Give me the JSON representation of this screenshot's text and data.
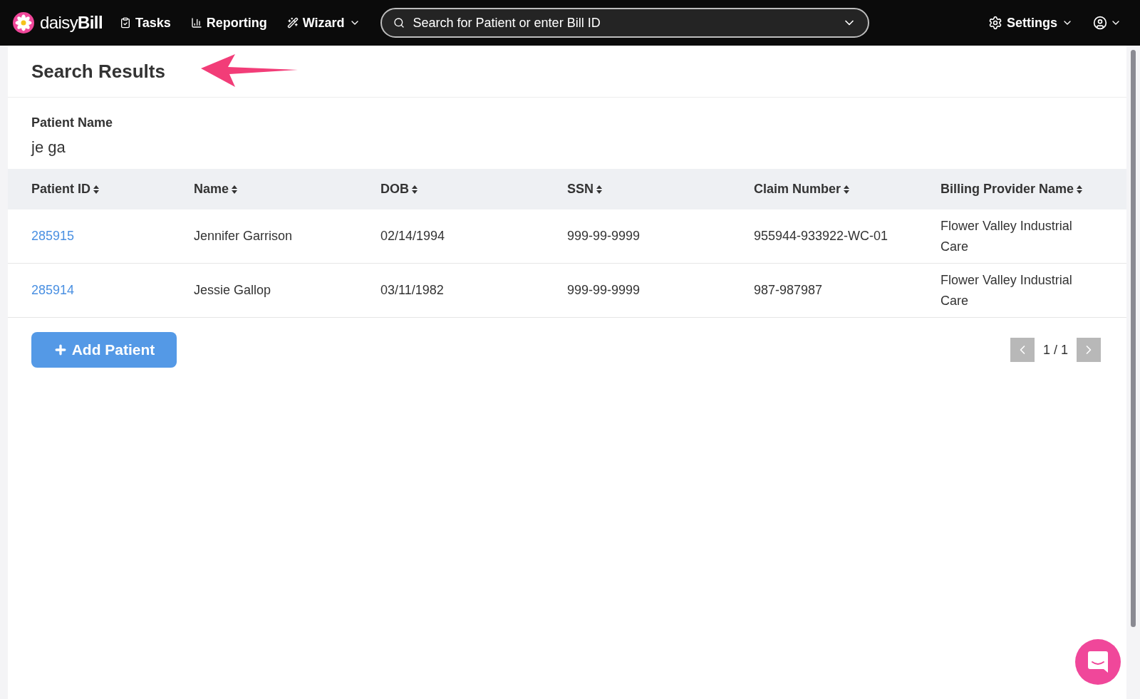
{
  "nav": {
    "brand_light": "daisy",
    "brand_bold": "Bill",
    "items": [
      {
        "kind": "tasks",
        "label": "Tasks",
        "dropdown": false
      },
      {
        "kind": "reporting",
        "label": "Reporting",
        "dropdown": false
      },
      {
        "kind": "wizard",
        "label": "Wizard",
        "dropdown": true
      }
    ],
    "search": {
      "placeholder": "Search for Patient or enter Bill ID"
    },
    "settings": "Settings"
  },
  "page": {
    "title": "Search Results",
    "filter_label": "Patient Name",
    "filter_value": "je ga"
  },
  "table": {
    "columns": [
      "Patient ID",
      "Name",
      "DOB",
      "SSN",
      "Claim Number",
      "Billing Provider Name"
    ],
    "rows": [
      [
        "285915",
        "Jennifer Garrison",
        "02/14/1994",
        "999-99-9999",
        "955944-933922-WC-01",
        "Flower Valley Industrial Care"
      ],
      [
        "285914",
        "Jessie Gallop",
        "03/11/1982",
        "999-99-9999",
        "987-987987",
        "Flower Valley Industrial Care"
      ]
    ]
  },
  "add_button": "Add Patient",
  "pagination": {
    "text": "1 / 1"
  }
}
